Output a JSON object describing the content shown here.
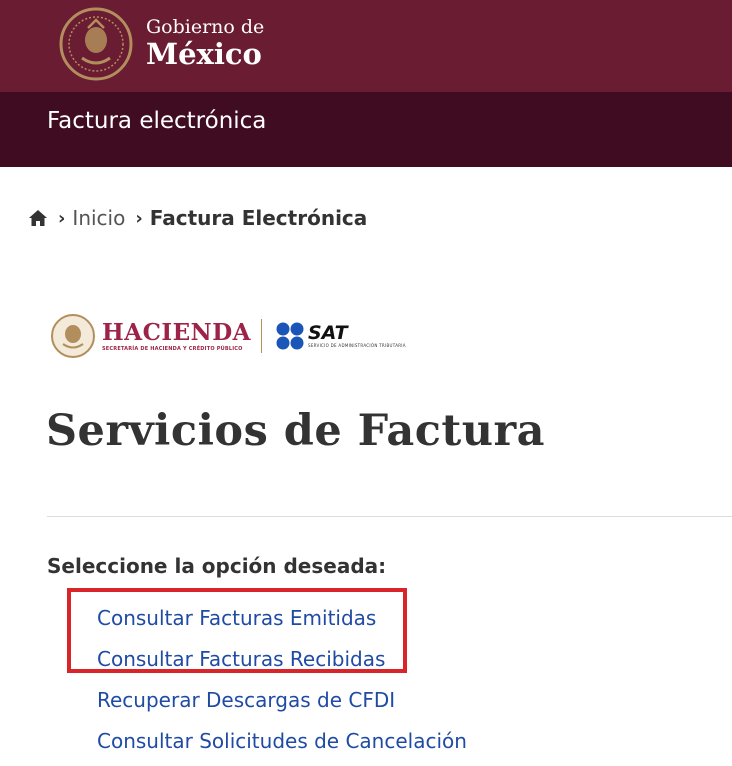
{
  "header": {
    "gov_line1": "Gobierno de",
    "gov_line2": "México",
    "section_title": "Factura electrónica"
  },
  "breadcrumb": {
    "home_icon": "home-icon",
    "items": [
      {
        "label": "Inicio"
      },
      {
        "label": "Factura Electrónica"
      }
    ],
    "separator": "›"
  },
  "logos": {
    "hacienda_word": "HACIENDA",
    "hacienda_sub": "SECRETARÍA DE HACIENDA Y CRÉDITO PÚBLICO",
    "sat_word": "SAT",
    "sat_sub": "SERVICIO DE ADMINISTRACIÓN TRIBUTARIA"
  },
  "main": {
    "title": "Servicios de Factura",
    "prompt": "Seleccione la opción deseada:",
    "options": [
      {
        "label": "Consultar Facturas Emitidas"
      },
      {
        "label": "Consultar Facturas Recibidas"
      },
      {
        "label": "Recuperar Descargas de CFDI"
      },
      {
        "label": "Consultar Solicitudes de Cancelación"
      }
    ]
  },
  "colors": {
    "gov_bar": "#691c32",
    "sub_bar": "#3f0c22",
    "link": "#1f4ba5",
    "highlight": "#d9242a",
    "hacienda": "#9d2449",
    "gold": "#b38e5d",
    "sat_blue": "#1a56b8"
  }
}
